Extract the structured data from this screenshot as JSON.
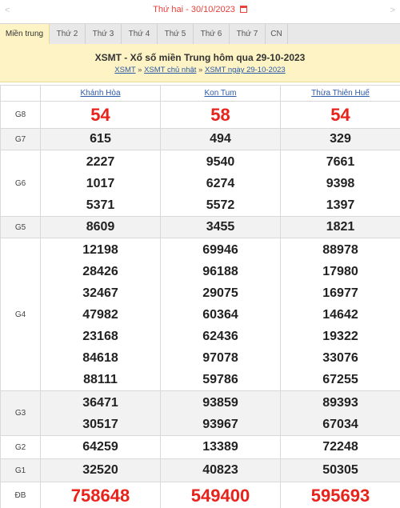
{
  "date_bar": {
    "prev_arrow": "<",
    "next_arrow": ">",
    "date_text": "Thứ hai - 30/10/2023"
  },
  "tabs": [
    {
      "label": "Miền trung"
    },
    {
      "label": "Thứ 2"
    },
    {
      "label": "Thứ 3"
    },
    {
      "label": "Thứ 4"
    },
    {
      "label": "Thứ 5"
    },
    {
      "label": "Thứ 6"
    },
    {
      "label": "Thứ 7"
    },
    {
      "label": "CN"
    }
  ],
  "header": {
    "title": "XSMT - Xổ số miền Trung hôm qua 29-10-2023",
    "crumb_1": "XSMT",
    "crumb_2": "XSMT chủ nhật",
    "crumb_3": "XSMT ngày 29-10-2023",
    "separator": "»"
  },
  "provinces": [
    "Khánh Hòa",
    "Kon Tum",
    "Thừa Thiên Huế"
  ],
  "prizes": {
    "g8": {
      "label": "G8",
      "values": [
        [
          "54"
        ],
        [
          "58"
        ],
        [
          "54"
        ]
      ]
    },
    "g7": {
      "label": "G7",
      "values": [
        [
          "615"
        ],
        [
          "494"
        ],
        [
          "329"
        ]
      ]
    },
    "g6": {
      "label": "G6",
      "values": [
        [
          "2227",
          "1017",
          "5371"
        ],
        [
          "9540",
          "6274",
          "5572"
        ],
        [
          "7661",
          "9398",
          "1397"
        ]
      ]
    },
    "g5": {
      "label": "G5",
      "values": [
        [
          "8609"
        ],
        [
          "3455"
        ],
        [
          "1821"
        ]
      ]
    },
    "g4": {
      "label": "G4",
      "values": [
        [
          "12198",
          "28426",
          "32467",
          "47982",
          "23168",
          "84618",
          "88111"
        ],
        [
          "69946",
          "96188",
          "29075",
          "60364",
          "62436",
          "97078",
          "59786"
        ],
        [
          "88978",
          "17980",
          "16977",
          "14642",
          "19322",
          "33076",
          "67255"
        ]
      ]
    },
    "g3": {
      "label": "G3",
      "values": [
        [
          "36471",
          "30517"
        ],
        [
          "93859",
          "93967"
        ],
        [
          "89393",
          "67034"
        ]
      ]
    },
    "g2": {
      "label": "G2",
      "values": [
        [
          "64259"
        ],
        [
          "13389"
        ],
        [
          "72248"
        ]
      ]
    },
    "g1": {
      "label": "G1",
      "values": [
        [
          "32520"
        ],
        [
          "40823"
        ],
        [
          "50305"
        ]
      ]
    },
    "db": {
      "label": "ĐB",
      "values": [
        [
          "758648"
        ],
        [
          "549400"
        ],
        [
          "595693"
        ]
      ]
    }
  },
  "colors": {
    "accent_red": "#e8231b",
    "header_bg": "#fdf3c4",
    "link_blue": "#2c5aa8"
  }
}
